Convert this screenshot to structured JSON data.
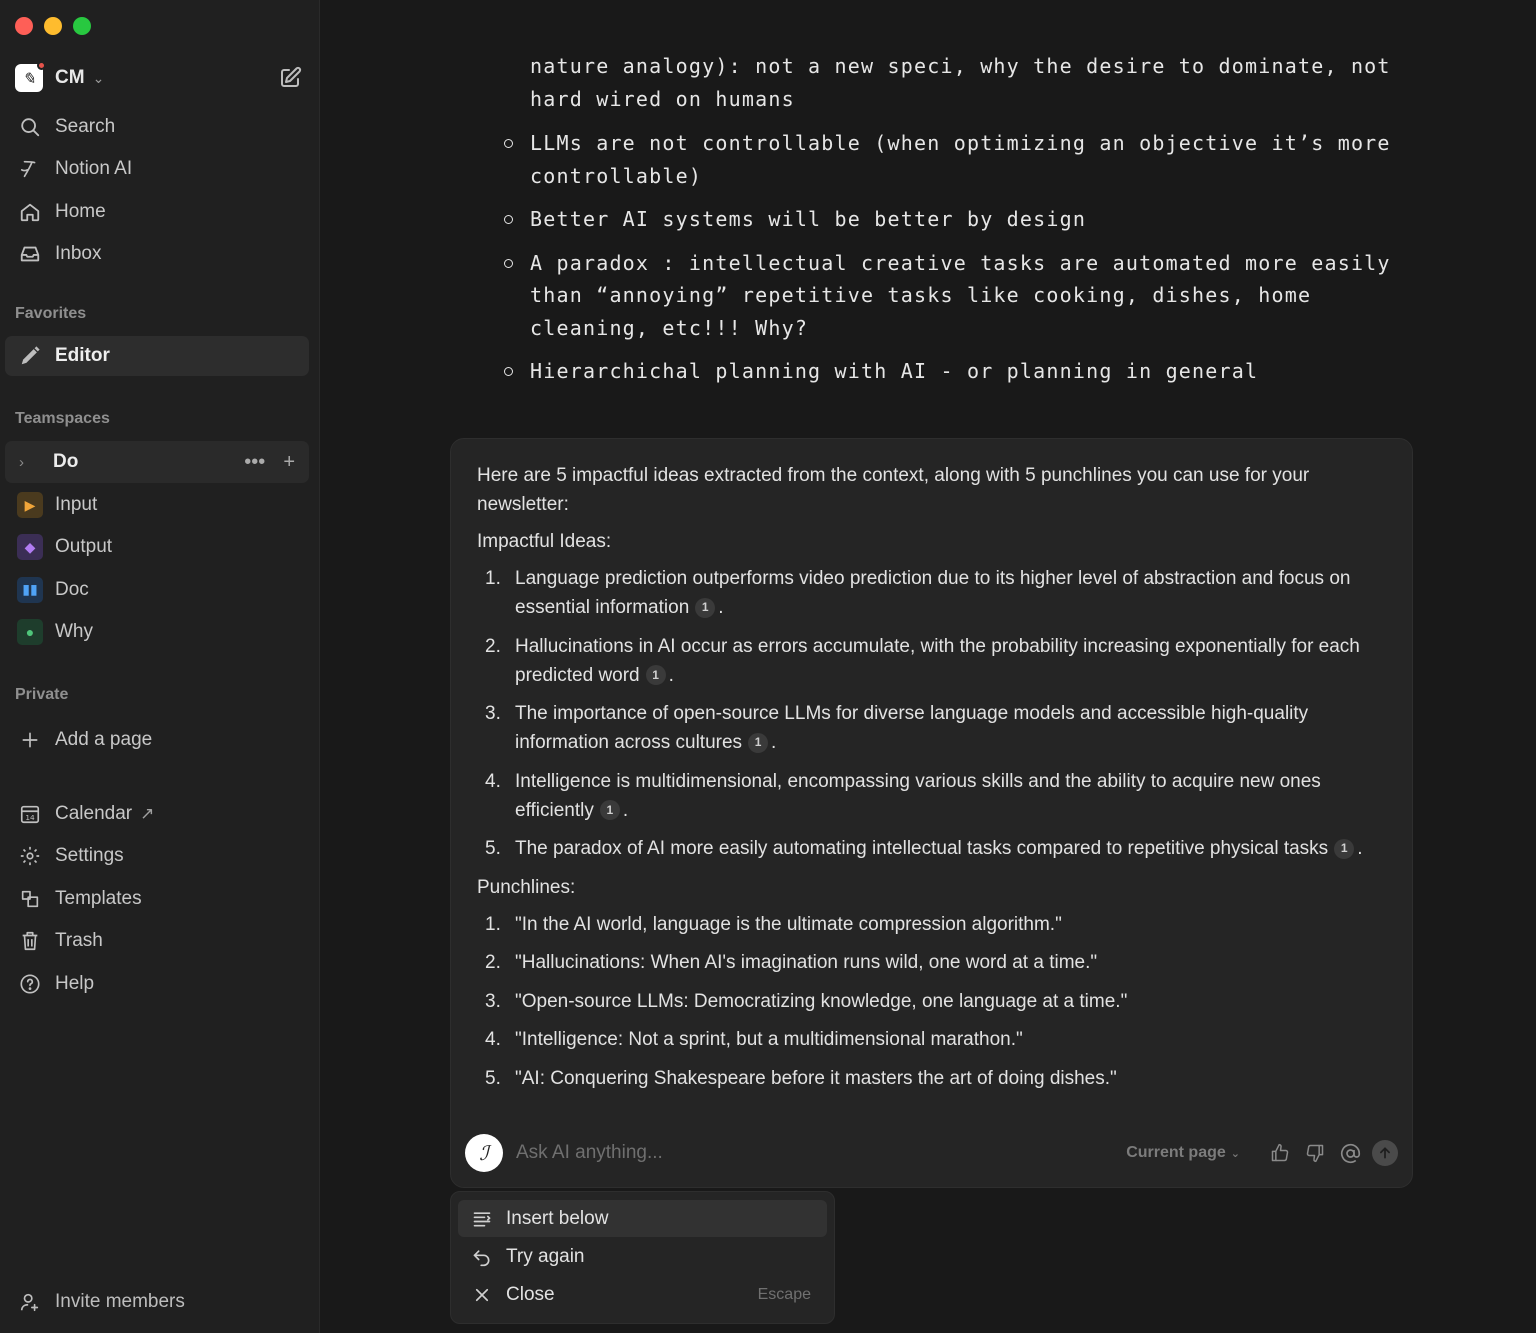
{
  "sidebar": {
    "workspace": {
      "name": "CM"
    },
    "top_nav": [
      {
        "label": "Search",
        "icon": "search-icon"
      },
      {
        "label": "Notion AI",
        "icon": "notion-ai-icon"
      },
      {
        "label": "Home",
        "icon": "home-icon"
      },
      {
        "label": "Inbox",
        "icon": "inbox-icon"
      }
    ],
    "favorites_label": "Favorites",
    "favorites": [
      {
        "label": "Editor",
        "icon": "pencil-icon"
      }
    ],
    "teamspaces_label": "Teamspaces",
    "teamspace": {
      "label": "Do"
    },
    "team_pages": [
      {
        "label": "Input",
        "icon": "input-page-icon"
      },
      {
        "label": "Output",
        "icon": "output-page-icon"
      },
      {
        "label": "Doc",
        "icon": "book-page-icon"
      },
      {
        "label": "Why",
        "icon": "why-page-icon"
      }
    ],
    "private_label": "Private",
    "add_page": "Add a page",
    "bottom_nav": [
      {
        "label": "Calendar",
        "icon": "calendar-icon"
      },
      {
        "label": "Settings",
        "icon": "settings-icon"
      },
      {
        "label": "Templates",
        "icon": "templates-icon"
      },
      {
        "label": "Trash",
        "icon": "trash-icon"
      },
      {
        "label": "Help",
        "icon": "help-icon"
      }
    ],
    "invite": "Invite members"
  },
  "document": {
    "fragment": "nature analogy): not a new speci, why the desire to dominate, not hard wired on humans",
    "bullets": [
      "LLMs are not controllable (when optimizing an objective it’s more controllable)",
      "Better AI systems will be better by design",
      "A paradox : intellectual creative tasks are automated more easily than “annoying” repetitive tasks like cooking, dishes, home cleaning, etc!!! Why?",
      "Hierarchichal planning with AI - or planning in general"
    ]
  },
  "ai_response": {
    "intro": "Here are 5 impactful ideas extracted from the context, along with 5 punchlines you can use for your newsletter:",
    "ideas_heading": "Impactful Ideas:",
    "ideas": [
      {
        "num": "1.",
        "text": "Language prediction outperforms video prediction due to its higher level of abstraction and focus on essential information",
        "cite": "1"
      },
      {
        "num": "2.",
        "text": "Hallucinations in AI occur as errors accumulate, with the probability increasing exponentially for each predicted word",
        "cite": "1"
      },
      {
        "num": "3.",
        "text": "The importance of open-source LLMs for diverse language models and accessible high-quality information across cultures",
        "cite": "1"
      },
      {
        "num": "4.",
        "text": "Intelligence is multidimensional, encompassing various skills and the ability to acquire new ones efficiently",
        "cite": "1"
      },
      {
        "num": "5.",
        "text": "The paradox of AI more easily automating intellectual tasks compared to repetitive physical tasks",
        "cite": "1"
      }
    ],
    "punchlines_heading": "Punchlines:",
    "punchlines": [
      {
        "num": "1.",
        "text": "\"In the AI world, language is the ultimate compression algorithm.\""
      },
      {
        "num": "2.",
        "text": "\"Hallucinations: When AI's imagination runs wild, one word at a time.\""
      },
      {
        "num": "3.",
        "text": "\"Open-source LLMs: Democratizing knowledge, one language at a time.\""
      },
      {
        "num": "4.",
        "text": "\"Intelligence: Not a sprint, but a multidimensional marathon.\""
      },
      {
        "num": "5.",
        "text": "\"AI: Conquering Shakespeare before it masters the art of doing dishes.\""
      }
    ],
    "input": {
      "placeholder": "Ask AI anything...",
      "value": ""
    },
    "scope": "Current page"
  },
  "menu": {
    "items": [
      {
        "label": "Insert below",
        "icon": "insert-below-icon",
        "shortcut": ""
      },
      {
        "label": "Try again",
        "icon": "undo-icon",
        "shortcut": ""
      },
      {
        "label": "Close",
        "icon": "close-icon",
        "shortcut": "Escape"
      }
    ]
  }
}
